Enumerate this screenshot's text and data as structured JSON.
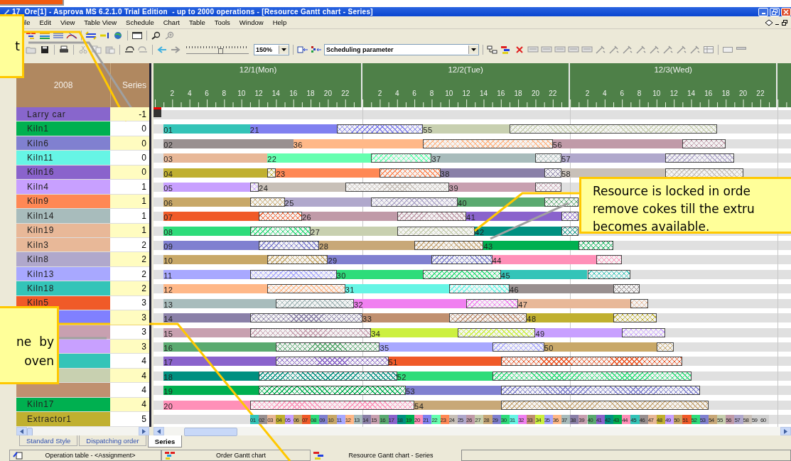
{
  "window": {
    "title": "17_Ore[1] - Asprova MS 6.2.1.0 Trial Edition  - up to 2000 operations - [Resource Gantt chart - Series]"
  },
  "menu": [
    "ile",
    "Edit",
    "View",
    "Table View",
    "Schedule",
    "Chart",
    "Table",
    "Tools",
    "Window",
    "Help"
  ],
  "toolbar": {
    "slider": {
      "level": 0.55
    },
    "zoom": "150%",
    "parameter": "Scheduling parameter"
  },
  "table": {
    "columns": [
      "2008",
      "Series"
    ]
  },
  "days": [
    {
      "label": "12/1(Mon)",
      "hours": [
        "2",
        "4",
        "6",
        "8",
        "10",
        "12",
        "14",
        "16",
        "18",
        "20",
        "22"
      ]
    },
    {
      "label": "12/2(Tue)",
      "hours": [
        "2",
        "4",
        "6",
        "8",
        "10",
        "12",
        "14",
        "16",
        "18",
        "20",
        "22"
      ]
    },
    {
      "label": "12/3(Wed)",
      "hours": [
        "2",
        "4",
        "6",
        "8",
        "10",
        "12",
        "14",
        "16",
        "18",
        "20",
        "22"
      ]
    }
  ],
  "resources": [
    {
      "name": "Larry car",
      "series": "-1",
      "color": "#8866cc"
    },
    {
      "name": "Kiln1",
      "series": "0",
      "color": "#00b050",
      "ops": [
        {
          "label": "01",
          "color": "#33c4b8"
        },
        {
          "label": "21",
          "color": "#8080f0"
        },
        {
          "label": "55",
          "color": "#c8d0b0"
        }
      ]
    },
    {
      "name": "Kiln6",
      "series": "0",
      "color": "#8080d0",
      "ops": [
        {
          "label": "02",
          "color": "#999090"
        },
        {
          "label": "36",
          "color": "#ffb888"
        },
        {
          "label": "56",
          "color": "#c09aa8"
        }
      ]
    },
    {
      "name": "Kiln11",
      "series": "0",
      "color": "#66f5e5",
      "ops": [
        {
          "label": "03",
          "color": "#e8b898"
        },
        {
          "label": "22",
          "color": "#66ffb0"
        },
        {
          "label": "37",
          "color": "#a8bcbc"
        },
        {
          "label": "57",
          "color": "#b0a8cc"
        }
      ]
    },
    {
      "name": "Kiln16",
      "series": "0",
      "color": "#8a63cc",
      "ops": [
        {
          "label": "04",
          "color": "#c0b030"
        },
        {
          "label": "23",
          "color": "#ff8855"
        },
        {
          "label": "38",
          "color": "#8a80a8"
        },
        {
          "label": "58",
          "color": "#c8c0b8"
        }
      ]
    },
    {
      "name": "Kiln4",
      "series": "1",
      "color": "#c8a0ff",
      "ops": [
        {
          "label": "05",
          "color": "#c8a0ff"
        },
        {
          "label": "24",
          "color": "#c8c0b8"
        },
        {
          "label": "39",
          "color": "#c8a0b0"
        }
      ]
    },
    {
      "name": "Kiln9",
      "series": "1",
      "color": "#ff8855",
      "ops": [
        {
          "label": "06",
          "color": "#c8a868"
        },
        {
          "label": "25",
          "color": "#b0a8cc"
        },
        {
          "label": "40",
          "color": "#5aaa70"
        }
      ]
    },
    {
      "name": "Kiln14",
      "series": "1",
      "color": "#a8bcbc",
      "ops": [
        {
          "label": "07",
          "color": "#f05a28"
        },
        {
          "label": "26",
          "color": "#c09aa8"
        },
        {
          "label": "41",
          "color": "#8a63cc"
        }
      ]
    },
    {
      "name": "Kiln19",
      "series": "1",
      "color": "#e8b898",
      "ops": [
        {
          "label": "08",
          "color": "#2edc7a"
        },
        {
          "label": "27",
          "color": "#c8d0b0"
        },
        {
          "label": "42",
          "color": "#009080"
        }
      ]
    },
    {
      "name": "Kiln3",
      "series": "2",
      "color": "#e8b898",
      "ops": [
        {
          "label": "09",
          "color": "#8080d0"
        },
        {
          "label": "28",
          "color": "#c8a878"
        },
        {
          "label": "43",
          "color": "#00b050"
        }
      ]
    },
    {
      "name": "Kiln8",
      "series": "2",
      "color": "#b0a8cc",
      "ops": [
        {
          "label": "10",
          "color": "#c8a868"
        },
        {
          "label": "29",
          "color": "#8080d0"
        },
        {
          "label": "44",
          "color": "#ff90b8"
        }
      ]
    },
    {
      "name": "Kiln13",
      "series": "2",
      "color": "#a8a8ff",
      "ops": [
        {
          "label": "11",
          "color": "#a8a8ff"
        },
        {
          "label": "30",
          "color": "#2edc7a"
        },
        {
          "label": "45",
          "color": "#33c4b8"
        }
      ]
    },
    {
      "name": "Kiln18",
      "series": "2",
      "color": "#33c4b8",
      "ops": [
        {
          "label": "12",
          "color": "#ffb888"
        },
        {
          "label": "31",
          "color": "#66f5e5"
        },
        {
          "label": "46",
          "color": "#999090"
        }
      ]
    },
    {
      "name": "Kiln5",
      "series": "3",
      "color": "#f05a28",
      "ops": [
        {
          "label": "13",
          "color": "#a8bcbc"
        },
        {
          "label": "32",
          "color": "#f080f0"
        },
        {
          "label": "47",
          "color": "#e8b898"
        }
      ]
    },
    {
      "series": "3",
      "color": "#8080ff",
      "ops": [
        {
          "label": "14",
          "color": "#8a80a8"
        },
        {
          "label": "33",
          "color": "#c09070"
        },
        {
          "label": "48",
          "color": "#c0b030"
        }
      ]
    },
    {
      "series": "3",
      "color": "#c8a0b0",
      "ops": [
        {
          "label": "15",
          "color": "#c8a0b0"
        },
        {
          "label": "34",
          "color": "#ccf040"
        },
        {
          "label": "49",
          "color": "#c8a0ff"
        }
      ]
    },
    {
      "series": "3",
      "color": "#c8a0ff",
      "ops": [
        {
          "label": "16",
          "color": "#5aaa70"
        },
        {
          "label": "35",
          "color": "#a8a8ff"
        },
        {
          "label": "50",
          "color": "#c8a868"
        }
      ]
    },
    {
      "series": "4",
      "color": "#33c4b8",
      "ops": [
        {
          "label": "17",
          "color": "#8a63cc"
        },
        {
          "label": "51",
          "color": "#f05a28"
        }
      ]
    },
    {
      "series": "4",
      "color": "#c8d0b0",
      "ops": [
        {
          "label": "18",
          "color": "#009080"
        },
        {
          "label": "52",
          "color": "#2edc7a"
        }
      ]
    },
    {
      "series": "4",
      "color": "#c09070",
      "ops": [
        {
          "label": "19",
          "color": "#00b050"
        },
        {
          "label": "53",
          "color": "#8080d0"
        }
      ]
    },
    {
      "name": "Kiln17",
      "series": "4",
      "color": "#00b050",
      "ops": [
        {
          "label": "20",
          "color": "#ff90b8"
        },
        {
          "label": "54",
          "color": "#c8a878"
        }
      ]
    },
    {
      "name": "Extractor1",
      "series": "5",
      "color": "#c0b030"
    }
  ],
  "extractor": {
    "labels": [
      "01",
      "02",
      "03",
      "04",
      "05",
      "06",
      "07",
      "08",
      "09",
      "10",
      "11",
      "12",
      "13",
      "14",
      "15",
      "16",
      "17",
      "18",
      "19",
      "20",
      "21",
      "22",
      "23",
      "24",
      "25",
      "26",
      "27",
      "28",
      "29",
      "30",
      "31",
      "32",
      "33",
      "34",
      "35",
      "36",
      "37",
      "38",
      "39",
      "40",
      "41",
      "42",
      "43",
      "44",
      "45",
      "46",
      "47",
      "48",
      "49",
      "50",
      "51",
      "52",
      "53",
      "54",
      "55",
      "56",
      "57",
      "58",
      "59",
      "60"
    ]
  },
  "tabs": [
    {
      "label": "Standard Style",
      "selected": false
    },
    {
      "label": "Dispatching order",
      "selected": false
    },
    {
      "label": "Series",
      "selected": true
    }
  ],
  "taskbar": [
    "Operation table - <Assignment>",
    "Order Gantt chart",
    "Resource Gantt chart - Series"
  ],
  "callouts": [
    {
      "kind": "top",
      "lines": [
        "t"
      ]
    },
    {
      "kind": "right",
      "lines": [
        "Resource is locked in orde",
        "remove cokes till the extru",
        "becomes available."
      ]
    },
    {
      "kind": "left",
      "lines": [
        "ne  by",
        "oven"
      ]
    }
  ]
}
